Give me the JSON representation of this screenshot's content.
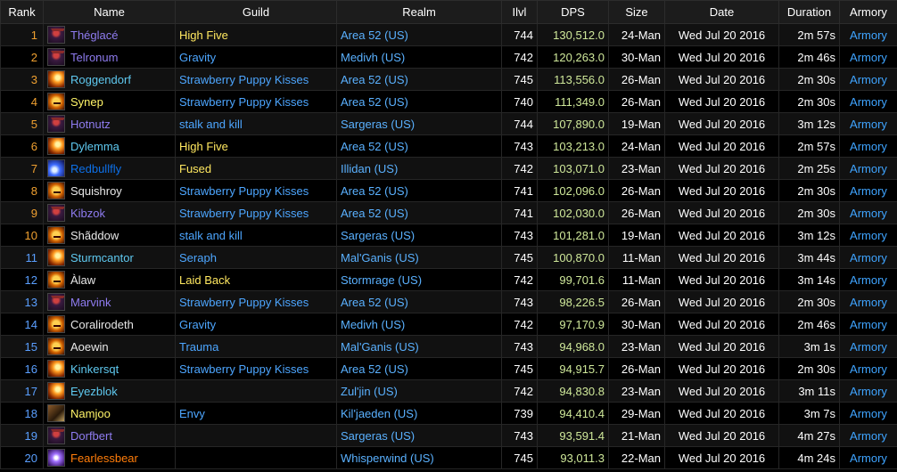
{
  "headers": {
    "rank": "Rank",
    "name": "Name",
    "guild": "Guild",
    "realm": "Realm",
    "ilvl": "Ilvl",
    "dps": "DPS",
    "size": "Size",
    "date": "Date",
    "duration": "Duration",
    "armory": "Armory"
  },
  "colors": {
    "warlock": "#8f7cf0",
    "mage": "#5fc9f0",
    "rogue": "#fff468",
    "shaman": "#0d70e8",
    "hunter": "#aad372",
    "monk": "#e8e8e8",
    "druid": "#ff7d0a",
    "rank": "#f0a030",
    "rank_blue": "#5a9fff"
  },
  "rows": [
    {
      "rank": "1",
      "name": "Théglacé",
      "name_color": "#8f7cf0",
      "icon": "demon-icon",
      "guild": "High Five",
      "guild_color": "yellow",
      "realm": "Area 52 (US)",
      "ilvl": "744",
      "dps": "130,512.0",
      "size": "24-Man",
      "date": "Wed Jul 20 2016",
      "duration": "2m 57s",
      "armory": "Armory"
    },
    {
      "rank": "2",
      "name": "Telronum",
      "name_color": "#8f7cf0",
      "icon": "demon-icon",
      "guild": "Gravity",
      "guild_color": "blue",
      "realm": "Medivh (US)",
      "ilvl": "742",
      "dps": "120,263.0",
      "size": "30-Man",
      "date": "Wed Jul 20 2016",
      "duration": "2m 46s",
      "armory": "Armory"
    },
    {
      "rank": "3",
      "name": "Roggendorf",
      "name_color": "#5fc9f0",
      "icon": "fire-icon",
      "guild": "Strawberry Puppy Kisses",
      "guild_color": "blue",
      "realm": "Area 52 (US)",
      "ilvl": "745",
      "dps": "113,556.0",
      "size": "26-Man",
      "date": "Wed Jul 20 2016",
      "duration": "2m 30s",
      "armory": "Armory"
    },
    {
      "rank": "4",
      "name": "Synep",
      "name_color": "#fff468",
      "icon": "face-icon",
      "guild": "Strawberry Puppy Kisses",
      "guild_color": "blue",
      "realm": "Area 52 (US)",
      "ilvl": "740",
      "dps": "111,349.0",
      "size": "26-Man",
      "date": "Wed Jul 20 2016",
      "duration": "2m 30s",
      "armory": "Armory"
    },
    {
      "rank": "5",
      "name": "Hotnutz",
      "name_color": "#8f7cf0",
      "icon": "demon-icon",
      "guild": "stalk and kill",
      "guild_color": "blue",
      "realm": "Sargeras (US)",
      "ilvl": "744",
      "dps": "107,890.0",
      "size": "19-Man",
      "date": "Wed Jul 20 2016",
      "duration": "3m 12s",
      "armory": "Armory"
    },
    {
      "rank": "6",
      "name": "Dylemma",
      "name_color": "#5fc9f0",
      "icon": "fire-icon",
      "guild": "High Five",
      "guild_color": "yellow",
      "realm": "Area 52 (US)",
      "ilvl": "743",
      "dps": "103,213.0",
      "size": "24-Man",
      "date": "Wed Jul 20 2016",
      "duration": "2m 57s",
      "armory": "Armory"
    },
    {
      "rank": "7",
      "name": "Redbullfly",
      "name_color": "#0d70e8",
      "icon": "arcane-icon",
      "guild": "Fused",
      "guild_color": "yellow",
      "realm": "Illidan (US)",
      "ilvl": "742",
      "dps": "103,071.0",
      "size": "23-Man",
      "date": "Wed Jul 20 2016",
      "duration": "2m 25s",
      "armory": "Armory"
    },
    {
      "rank": "8",
      "name": "Squishroy",
      "name_color": "#e8e8e8",
      "icon": "face-icon",
      "guild": "Strawberry Puppy Kisses",
      "guild_color": "blue",
      "realm": "Area 52 (US)",
      "ilvl": "741",
      "dps": "102,096.0",
      "size": "26-Man",
      "date": "Wed Jul 20 2016",
      "duration": "2m 30s",
      "armory": "Armory"
    },
    {
      "rank": "9",
      "name": "Kibzok",
      "name_color": "#8f7cf0",
      "icon": "demon-icon",
      "guild": "Strawberry Puppy Kisses",
      "guild_color": "blue",
      "realm": "Area 52 (US)",
      "ilvl": "741",
      "dps": "102,030.0",
      "size": "26-Man",
      "date": "Wed Jul 20 2016",
      "duration": "2m 30s",
      "armory": "Armory"
    },
    {
      "rank": "10",
      "name": "Shãddow",
      "name_color": "#e8e8e8",
      "icon": "face-icon",
      "guild": "stalk and kill",
      "guild_color": "blue",
      "realm": "Sargeras (US)",
      "ilvl": "743",
      "dps": "101,281.0",
      "size": "19-Man",
      "date": "Wed Jul 20 2016",
      "duration": "3m 12s",
      "armory": "Armory"
    },
    {
      "rank": "11",
      "name": "Sturmcantor",
      "name_color": "#5fc9f0",
      "icon": "fire-icon",
      "guild": "Seraph",
      "guild_color": "blue",
      "realm": "Mal'Ganis (US)",
      "ilvl": "745",
      "dps": "100,870.0",
      "size": "11-Man",
      "date": "Wed Jul 20 2016",
      "duration": "3m 44s",
      "armory": "Armory"
    },
    {
      "rank": "12",
      "name": "Àlaw",
      "name_color": "#e8e8e8",
      "icon": "face-icon",
      "guild": "Laid Back",
      "guild_color": "yellow",
      "realm": "Stormrage (US)",
      "ilvl": "742",
      "dps": "99,701.6",
      "size": "11-Man",
      "date": "Wed Jul 20 2016",
      "duration": "3m 14s",
      "armory": "Armory"
    },
    {
      "rank": "13",
      "name": "Marvink",
      "name_color": "#8f7cf0",
      "icon": "demon-icon",
      "guild": "Strawberry Puppy Kisses",
      "guild_color": "blue",
      "realm": "Area 52 (US)",
      "ilvl": "743",
      "dps": "98,226.5",
      "size": "26-Man",
      "date": "Wed Jul 20 2016",
      "duration": "2m 30s",
      "armory": "Armory"
    },
    {
      "rank": "14",
      "name": "Coralirodeth",
      "name_color": "#e8e8e8",
      "icon": "face-icon",
      "guild": "Gravity",
      "guild_color": "blue",
      "realm": "Medivh (US)",
      "ilvl": "742",
      "dps": "97,170.9",
      "size": "30-Man",
      "date": "Wed Jul 20 2016",
      "duration": "2m 46s",
      "armory": "Armory"
    },
    {
      "rank": "15",
      "name": "Aoewin",
      "name_color": "#e8e8e8",
      "icon": "face-icon",
      "guild": "Trauma",
      "guild_color": "blue",
      "realm": "Mal'Ganis (US)",
      "ilvl": "743",
      "dps": "94,968.0",
      "size": "23-Man",
      "date": "Wed Jul 20 2016",
      "duration": "3m 1s",
      "armory": "Armory"
    },
    {
      "rank": "16",
      "name": "Kinkersqt",
      "name_color": "#5fc9f0",
      "icon": "fire-icon",
      "guild": "Strawberry Puppy Kisses",
      "guild_color": "blue",
      "realm": "Area 52 (US)",
      "ilvl": "745",
      "dps": "94,915.7",
      "size": "26-Man",
      "date": "Wed Jul 20 2016",
      "duration": "2m 30s",
      "armory": "Armory"
    },
    {
      "rank": "17",
      "name": "Eyezblok",
      "name_color": "#5fc9f0",
      "icon": "fire-icon",
      "guild": "",
      "guild_color": "blue",
      "realm": "Zul'jin (US)",
      "ilvl": "742",
      "dps": "94,830.8",
      "size": "23-Man",
      "date": "Wed Jul 20 2016",
      "duration": "3m 11s",
      "armory": "Armory"
    },
    {
      "rank": "18",
      "name": "Namjoo",
      "name_color": "#fff468",
      "icon": "rogue-icon",
      "guild": "Envy",
      "guild_color": "blue",
      "realm": "Kil'jaeden (US)",
      "ilvl": "739",
      "dps": "94,410.4",
      "size": "29-Man",
      "date": "Wed Jul 20 2016",
      "duration": "3m 7s",
      "armory": "Armory"
    },
    {
      "rank": "19",
      "name": "Dorfbert",
      "name_color": "#8f7cf0",
      "icon": "demon-icon",
      "guild": "",
      "guild_color": "blue",
      "realm": "Sargeras (US)",
      "ilvl": "743",
      "dps": "93,591.4",
      "size": "21-Man",
      "date": "Wed Jul 20 2016",
      "duration": "4m 27s",
      "armory": "Armory"
    },
    {
      "rank": "20",
      "name": "Fearlessbear",
      "name_color": "#ff7d0a",
      "icon": "void-icon",
      "guild": "",
      "guild_color": "blue",
      "realm": "Whisperwind (US)",
      "ilvl": "745",
      "dps": "93,011.3",
      "size": "22-Man",
      "date": "Wed Jul 20 2016",
      "duration": "4m 24s",
      "armory": "Armory"
    }
  ]
}
